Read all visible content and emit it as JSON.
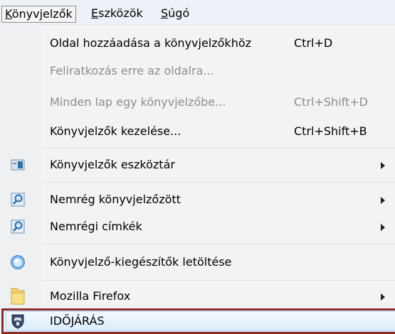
{
  "menubar": {
    "items": [
      {
        "mnemonic": "K",
        "rest": "önyvjelzők"
      },
      {
        "mnemonic": "E",
        "rest": "szközök"
      },
      {
        "mnemonic": "S",
        "rest": "úgó"
      }
    ]
  },
  "menu": {
    "items": [
      {
        "label": "Oldal hozzáadása a könyvjelzőkhöz",
        "shortcut": "Ctrl+D"
      },
      {
        "label": "Feliratkozás erre az oldalra...",
        "shortcut": ""
      },
      {
        "label": "Minden lap egy könyvjelzőbe...",
        "shortcut": "Ctrl+Shift+D"
      },
      {
        "label": "Könyvjelzők kezelése...",
        "shortcut": "Ctrl+Shift+B"
      },
      {
        "label": "Könyvjelzők eszköztár",
        "icon": "toolbar-icon"
      },
      {
        "label": "Nemrég könyvjelzőzött",
        "icon": "search-icon"
      },
      {
        "label": "Nemrégi címkék",
        "icon": "search-icon"
      },
      {
        "label": "Könyvjelző-kiegészítők letöltése",
        "icon": "addon-icon"
      },
      {
        "label": "Mozilla Firefox",
        "icon": "folder-icon"
      },
      {
        "label": "IDŐJÁRÁS",
        "icon": "shield-icon"
      }
    ]
  },
  "colors": {
    "highlight_border": "#8b2b2b",
    "disabled_text": "#8d8d8d"
  }
}
